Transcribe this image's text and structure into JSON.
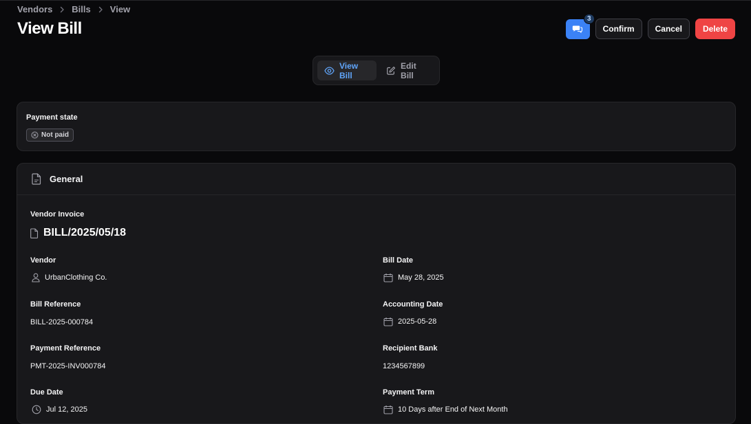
{
  "breadcrumb": [
    "Vendors",
    "Bills",
    "View"
  ],
  "page_title": "View Bill",
  "header": {
    "chat_count": "3",
    "confirm_label": "Confirm",
    "cancel_label": "Cancel",
    "delete_label": "Delete"
  },
  "tabs": [
    {
      "label": "View Bill",
      "icon": "eye-icon",
      "active": true
    },
    {
      "label": "Edit Bill",
      "icon": "pencil-icon",
      "active": false
    }
  ],
  "payment_state": {
    "label": "Payment state",
    "badge": "Not paid",
    "badge_icon": "x-circle-icon"
  },
  "general": {
    "title": "General",
    "vendor_invoice_label": "Vendor Invoice",
    "vendor_invoice_value": "BILL/2025/05/18",
    "fields": {
      "vendor": {
        "label": "Vendor",
        "value": "UrbanClothing Co.",
        "icon": "user-icon"
      },
      "bill_date": {
        "label": "Bill Date",
        "value": "May 28, 2025",
        "icon": "calendar-icon"
      },
      "bill_reference": {
        "label": "Bill Reference",
        "value": "BILL-2025-000784"
      },
      "accounting_date": {
        "label": "Accounting Date",
        "value": "2025-05-28",
        "icon": "calendar-icon"
      },
      "payment_reference": {
        "label": "Payment Reference",
        "value": "PMT-2025-INV000784"
      },
      "recipient_bank": {
        "label": "Recipient Bank",
        "value": "1234567899"
      },
      "due_date": {
        "label": "Due Date",
        "value": "Jul 12, 2025",
        "icon": "clock-icon"
      },
      "payment_term": {
        "label": "Payment Term",
        "value": "10 Days after End of Next Month",
        "icon": "calendar-icon"
      }
    }
  },
  "colors": {
    "background": "#09090b",
    "card": "#18181b",
    "border": "#27272a",
    "accent": "#3b82f6",
    "danger": "#ef4444",
    "tab_active_text": "#60a5fa"
  }
}
